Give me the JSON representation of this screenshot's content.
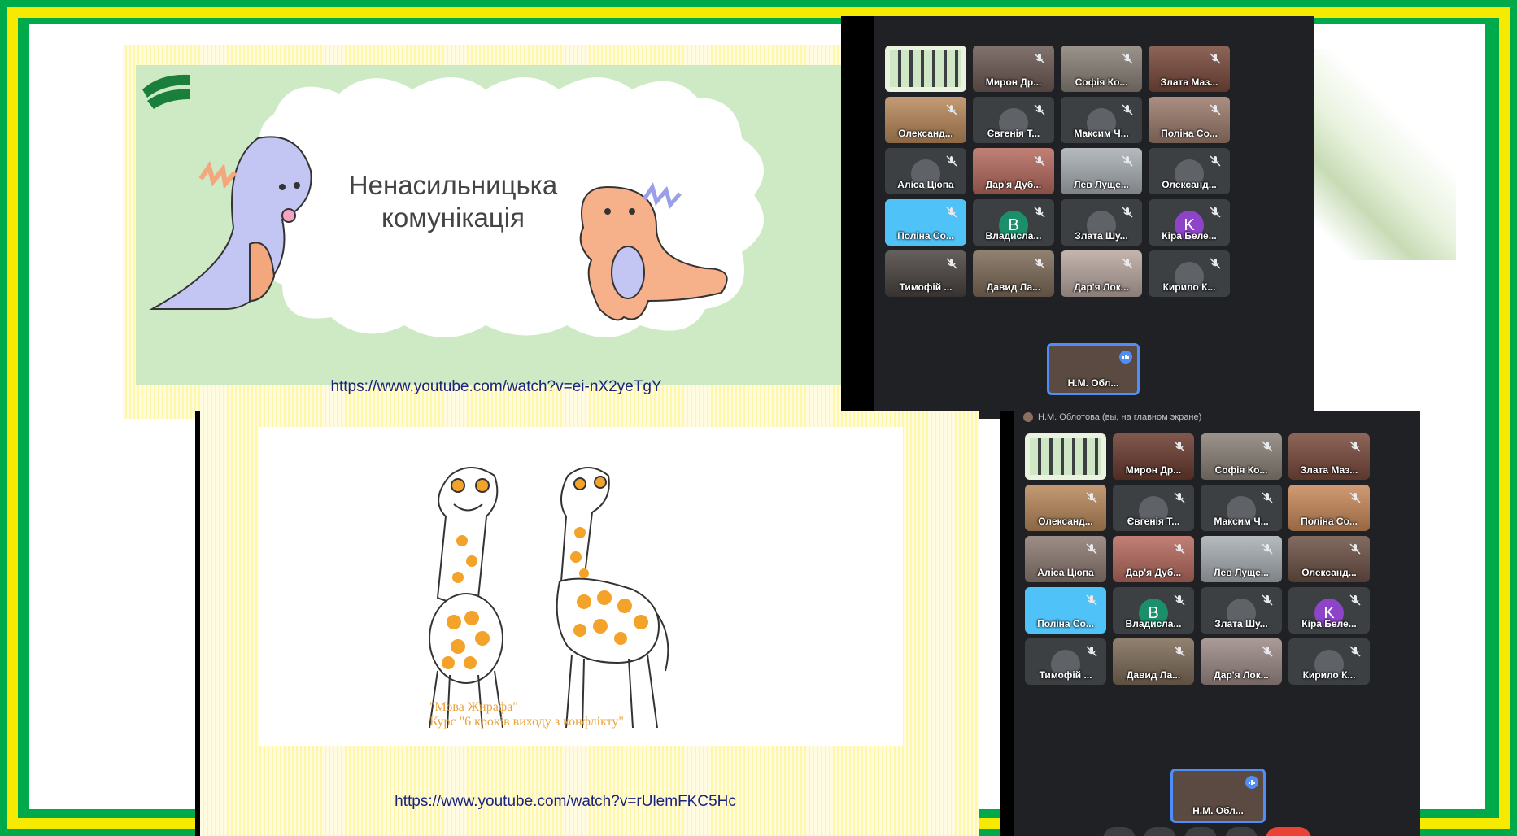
{
  "slide_top": {
    "title_line1": "Ненасильницька",
    "title_line2": "комунікація",
    "link": "https://www.youtube.com/watch?v=ei-nX2yeTgY"
  },
  "slide_bottom": {
    "caption_line1": "\"Мова Жирафа\"",
    "caption_line2": "Курс \"6 кроків виходу з конфлікту\"",
    "link": "https://www.youtube.com/watch?v=rUlemFKC5Hc"
  },
  "meet_top": {
    "participants": [
      {
        "name": "",
        "kind": "screen"
      },
      {
        "name": "Мирон Др...",
        "kind": "video",
        "color": "#6d5a55"
      },
      {
        "name": "Софія Ко...",
        "kind": "video",
        "color": "#8a8177"
      },
      {
        "name": "Злата Маз...",
        "kind": "video",
        "color": "#7a4a3c"
      },
      {
        "name": "Олександ...",
        "kind": "video",
        "color": "#b9895b"
      },
      {
        "name": "Євгенія Т...",
        "kind": "icon",
        "color": "#3c4043"
      },
      {
        "name": "Максим Ч...",
        "kind": "icon",
        "color": "#3c4043"
      },
      {
        "name": "Поліна Со...",
        "kind": "video",
        "color": "#9c7b6c"
      },
      {
        "name": "Аліса Цюпа",
        "kind": "icon",
        "color": "#3c4043"
      },
      {
        "name": "Дар'я Дуб...",
        "kind": "video",
        "color": "#b66a5e"
      },
      {
        "name": "Лев Луще...",
        "kind": "video",
        "color": "#a9afb5"
      },
      {
        "name": "Олександ...",
        "kind": "icon",
        "color": "#3c4043"
      },
      {
        "name": "Поліна Со...",
        "kind": "solid",
        "color": "#4fc3f7"
      },
      {
        "name": "Владисла...",
        "kind": "letter",
        "letter": "В",
        "color": "#1b8f6a"
      },
      {
        "name": "Злата Шу...",
        "kind": "icon",
        "color": "#3c4043"
      },
      {
        "name": "Кіра Беле...",
        "kind": "letter",
        "letter": "K",
        "color": "#8e44c9"
      },
      {
        "name": "Тимофій ...",
        "kind": "video",
        "color": "#4a4440"
      },
      {
        "name": "Давид Ла...",
        "kind": "video",
        "color": "#7d6b58"
      },
      {
        "name": "Дар'я Лок...",
        "kind": "video",
        "color": "#b9a7a0"
      },
      {
        "name": "Кирило К...",
        "kind": "icon",
        "color": "#3c4043"
      }
    ],
    "presenter": "Н.М. Обл..."
  },
  "meet_bottom": {
    "header": "Н.М. Облотова (вы, на главном экране)",
    "participants": [
      {
        "name": "",
        "kind": "screen"
      },
      {
        "name": "Мирон Др...",
        "kind": "video",
        "color": "#6b3b2f"
      },
      {
        "name": "Софія Ко...",
        "kind": "video",
        "color": "#8a8177"
      },
      {
        "name": "Злата Маз...",
        "kind": "video",
        "color": "#7a4a3c"
      },
      {
        "name": "Олександ...",
        "kind": "video",
        "color": "#b9895b"
      },
      {
        "name": "Євгенія Т...",
        "kind": "icon",
        "color": "#3c4043"
      },
      {
        "name": "Максим Ч...",
        "kind": "icon",
        "color": "#3c4043"
      },
      {
        "name": "Поліна Со...",
        "kind": "video",
        "color": "#c98a5b"
      },
      {
        "name": "Аліса Цюпа",
        "kind": "video",
        "color": "#8d7a72"
      },
      {
        "name": "Дар'я Дуб...",
        "kind": "video",
        "color": "#b66a5e"
      },
      {
        "name": "Лев Луще...",
        "kind": "video",
        "color": "#a9afb5"
      },
      {
        "name": "Олександ...",
        "kind": "video",
        "color": "#6d5246"
      },
      {
        "name": "Поліна Со...",
        "kind": "solid",
        "color": "#4fc3f7"
      },
      {
        "name": "Владисла...",
        "kind": "letter",
        "letter": "В",
        "color": "#1b8f6a"
      },
      {
        "name": "Злата Шу...",
        "kind": "icon",
        "color": "#3c4043"
      },
      {
        "name": "Кіра Беле...",
        "kind": "letter",
        "letter": "K",
        "color": "#8e44c9"
      },
      {
        "name": "Тимофій ...",
        "kind": "icon",
        "color": "#3c4043"
      },
      {
        "name": "Давид Ла...",
        "kind": "video",
        "color": "#7d6b58"
      },
      {
        "name": "Дар'я Лок...",
        "kind": "video",
        "color": "#9c8a86"
      },
      {
        "name": "Кирило К...",
        "kind": "icon",
        "color": "#3c4043"
      }
    ],
    "presenter": "Н.М. Обл..."
  }
}
